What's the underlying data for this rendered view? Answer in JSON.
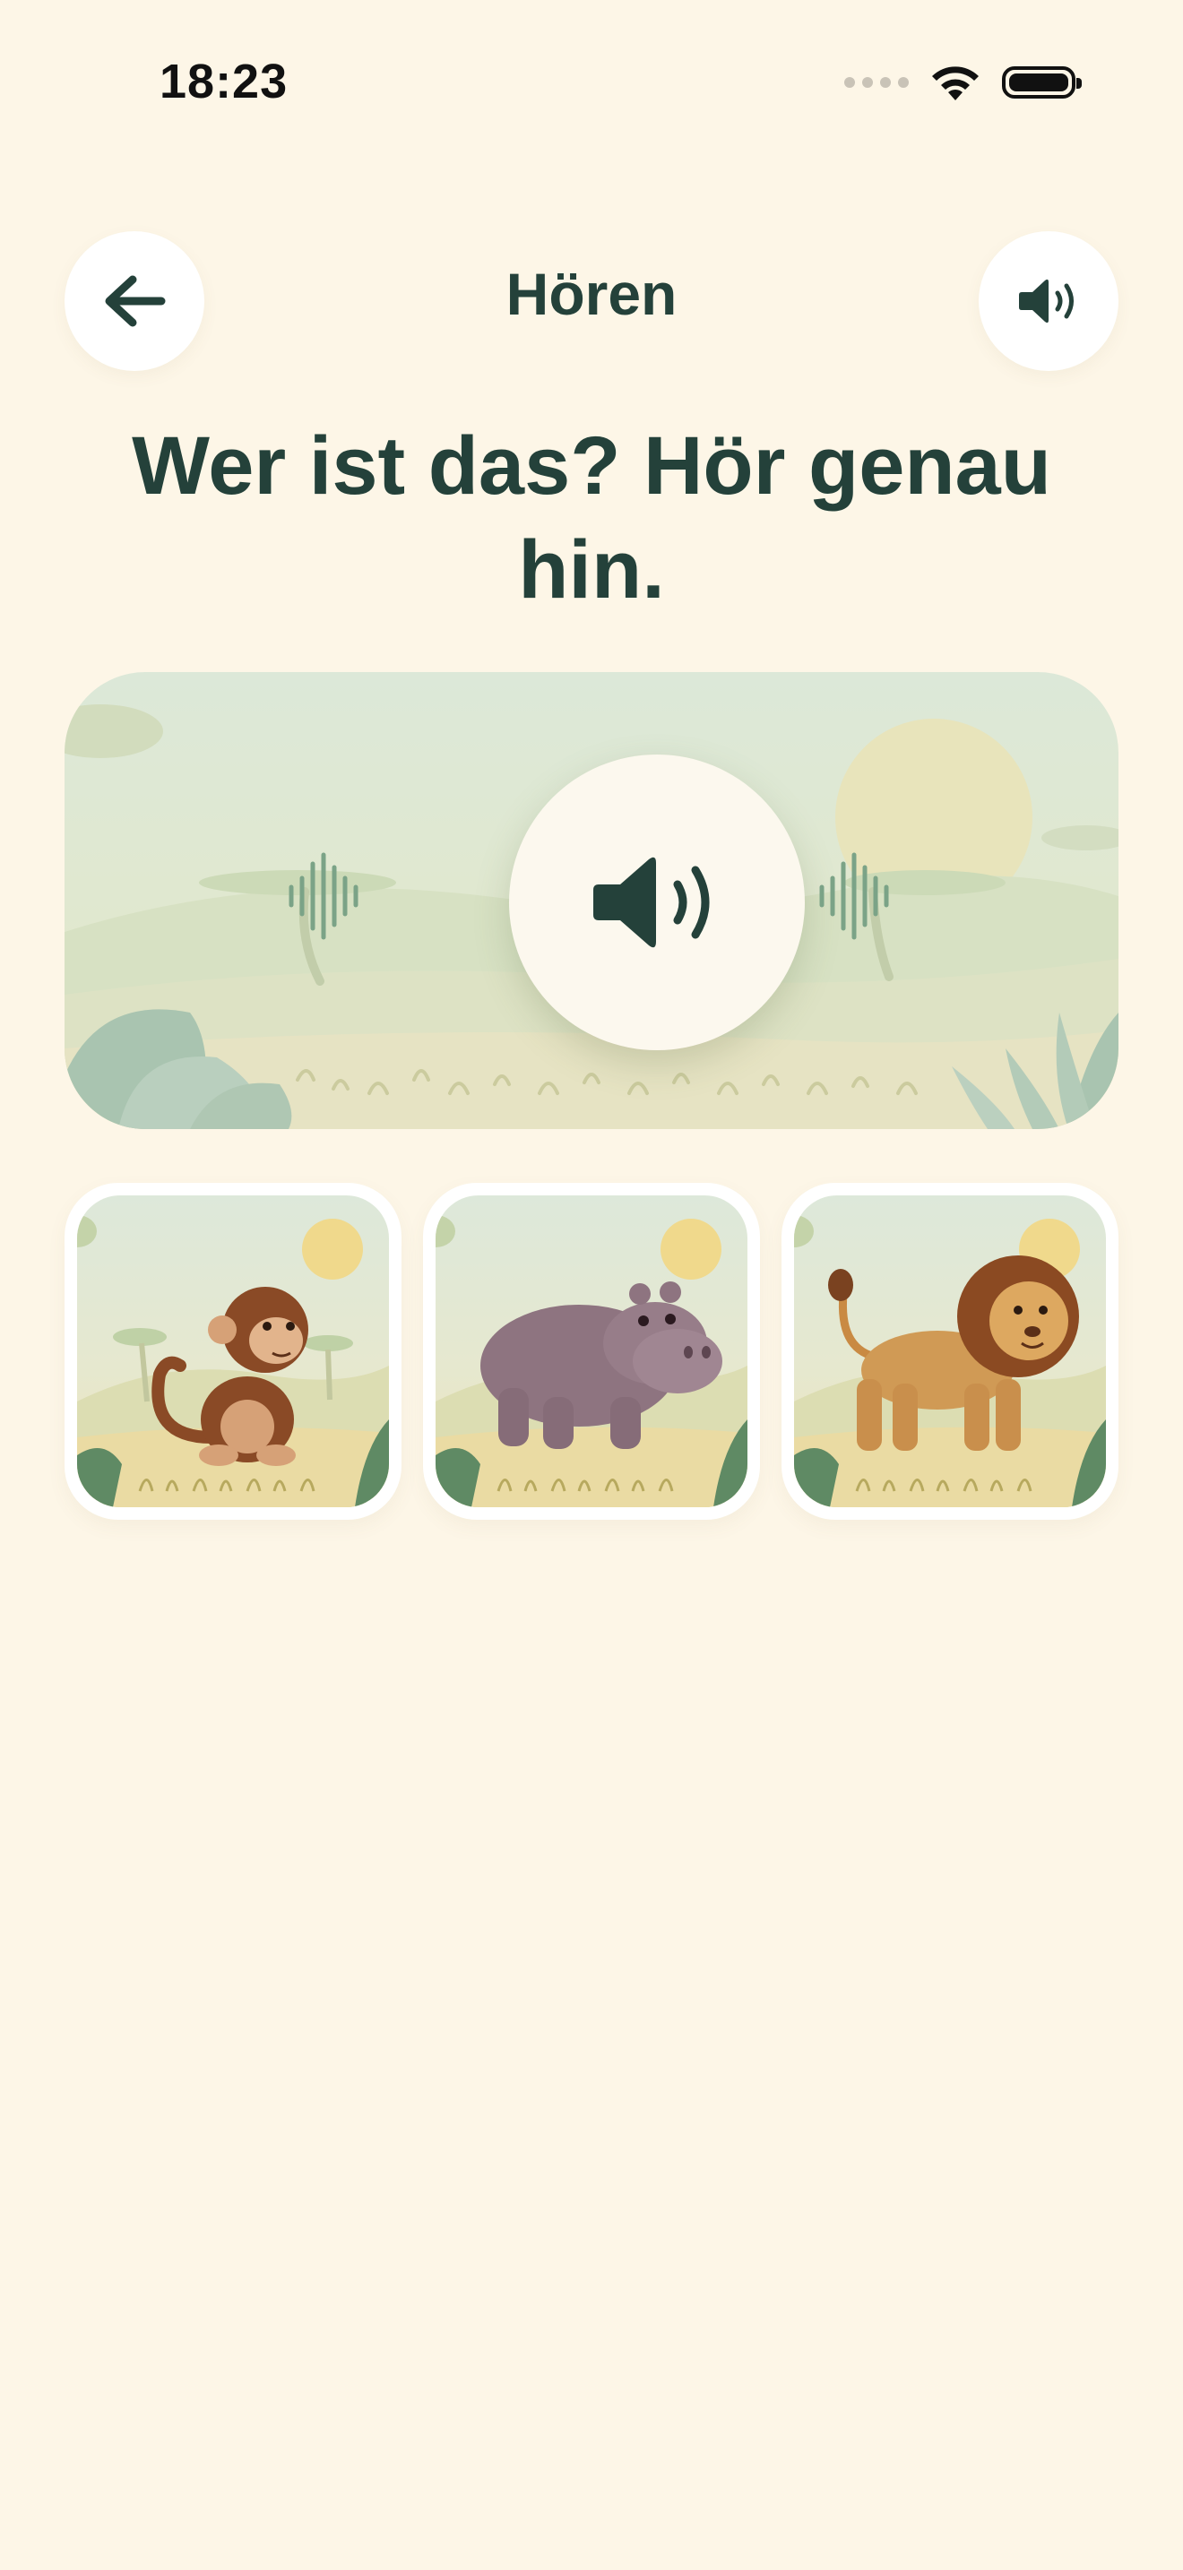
{
  "status_bar": {
    "time": "18:23",
    "icons": [
      "signal-dots-icon",
      "wifi-icon",
      "battery-icon"
    ]
  },
  "header": {
    "title": "Hören",
    "back_icon": "arrow-left-icon",
    "sound_icon": "speaker-icon"
  },
  "question": {
    "text": "Wer ist das? Hör genau hin."
  },
  "audio_card": {
    "play_icon": "speaker-large-icon",
    "wave_icon": "sound-wave-icon"
  },
  "choices": [
    {
      "animal": "monkey",
      "icon": "monkey-illustration"
    },
    {
      "animal": "hippo",
      "icon": "hippo-illustration"
    },
    {
      "animal": "lion",
      "icon": "lion-illustration"
    }
  ],
  "colors": {
    "background": "#FDF6E7",
    "primary_text": "#24413A",
    "card_white": "#FFFFFF",
    "savanna_green": "#CFDDBF",
    "accent_sun": "#EED98A"
  }
}
